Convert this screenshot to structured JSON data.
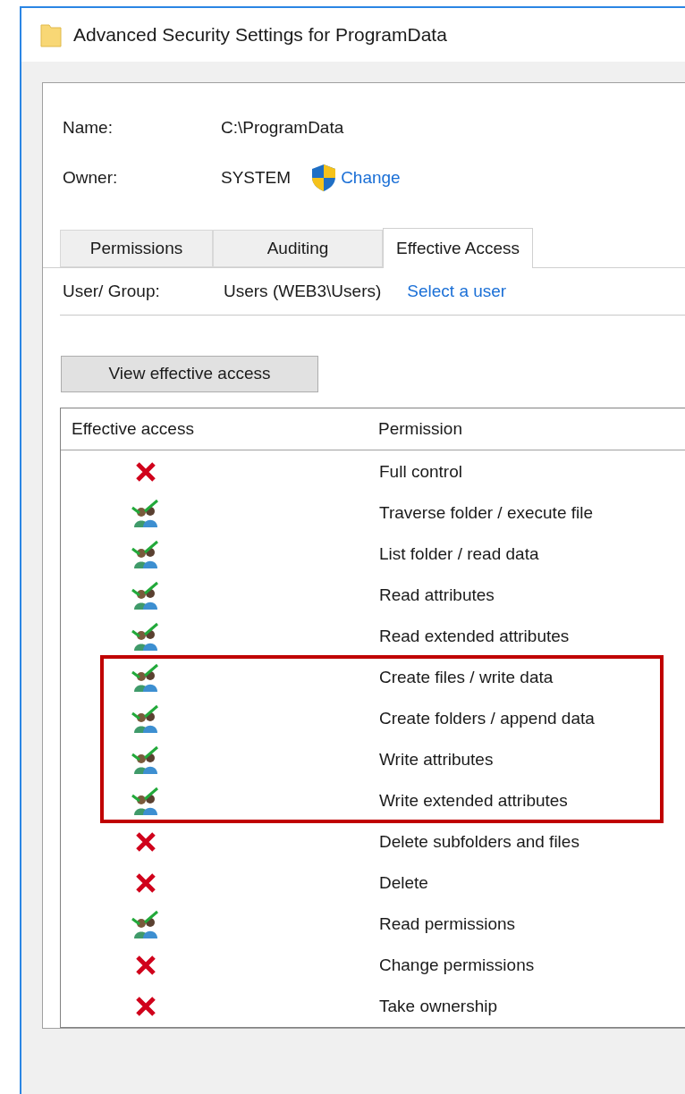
{
  "window": {
    "title": "Advanced Security Settings for ProgramData"
  },
  "fields": [
    {
      "label": "Name:",
      "value": "C:\\ProgramData"
    },
    {
      "label": "Owner:",
      "value": "SYSTEM",
      "link": "Change"
    }
  ],
  "tabs": [
    {
      "label": "Permissions",
      "selected": false
    },
    {
      "label": "Auditing",
      "selected": false
    },
    {
      "label": "Effective Access",
      "selected": true
    }
  ],
  "user_group": {
    "label": "User/ Group:",
    "value": "Users (WEB3\\Users)",
    "link": "Select a user"
  },
  "view_button": "View effective access",
  "table": {
    "columns": [
      "Effective access",
      "Permission"
    ],
    "rows": [
      {
        "kind": "denied",
        "permission": "Full control",
        "highlighted": false
      },
      {
        "kind": "allowed",
        "permission": "Traverse folder / execute file",
        "highlighted": false
      },
      {
        "kind": "allowed",
        "permission": "List folder / read data",
        "highlighted": false
      },
      {
        "kind": "allowed",
        "permission": "Read attributes",
        "highlighted": false
      },
      {
        "kind": "allowed",
        "permission": "Read extended attributes",
        "highlighted": false
      },
      {
        "kind": "allowed",
        "permission": "Create files / write data",
        "highlighted": true
      },
      {
        "kind": "allowed",
        "permission": "Create folders / append data",
        "highlighted": true
      },
      {
        "kind": "allowed",
        "permission": "Write attributes",
        "highlighted": true
      },
      {
        "kind": "allowed",
        "permission": "Write extended attributes",
        "highlighted": true
      },
      {
        "kind": "denied",
        "permission": "Delete subfolders and files",
        "highlighted": false
      },
      {
        "kind": "denied",
        "permission": "Delete",
        "highlighted": false
      },
      {
        "kind": "allowed",
        "permission": "Read permissions",
        "highlighted": false
      },
      {
        "kind": "denied",
        "permission": "Change permissions",
        "highlighted": false
      },
      {
        "kind": "denied",
        "permission": "Take ownership",
        "highlighted": false
      }
    ]
  }
}
